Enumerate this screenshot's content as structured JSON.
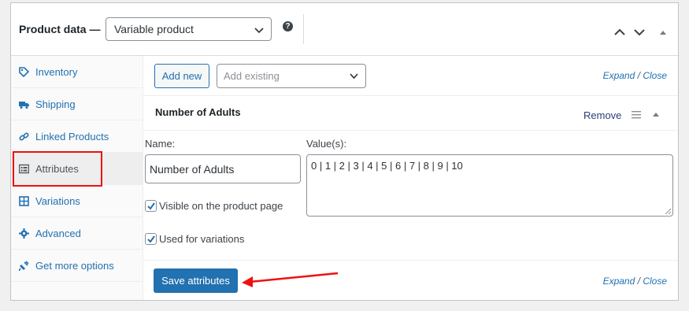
{
  "header": {
    "title": "Product data —",
    "product_type": "Variable product",
    "help_icon": "?"
  },
  "sidebar": {
    "items": [
      {
        "label": "Inventory",
        "icon": "tag-icon"
      },
      {
        "label": "Shipping",
        "icon": "truck-icon"
      },
      {
        "label": "Linked Products",
        "icon": "link-icon"
      },
      {
        "label": "Attributes",
        "icon": "list-view-icon"
      },
      {
        "label": "Variations",
        "icon": "grid-icon"
      },
      {
        "label": "Advanced",
        "icon": "gear-icon"
      },
      {
        "label": "Get more options",
        "icon": "plugin-icon"
      }
    ],
    "active_index": 3
  },
  "toolbar": {
    "add_new": "Add new",
    "add_existing_placeholder": "Add existing",
    "expand": "Expand",
    "sep": "/",
    "close": "Close"
  },
  "attribute": {
    "title": "Number of Adults",
    "remove": "Remove",
    "name_label": "Name:",
    "values_label": "Value(s):",
    "name_value": "Number of Adults",
    "values_value": "0 | 1 | 2 | 3 | 4 | 5 | 6 | 7 | 8 | 9 | 10",
    "visible_label": "Visible on the product page",
    "visible_checked": true,
    "variations_label": "Used for variations",
    "variations_checked": true
  },
  "footer": {
    "save": "Save attributes",
    "expand": "Expand",
    "sep": "/",
    "close": "Close"
  },
  "colors": {
    "accent": "#2271b1",
    "highlight": "#ee1111"
  }
}
